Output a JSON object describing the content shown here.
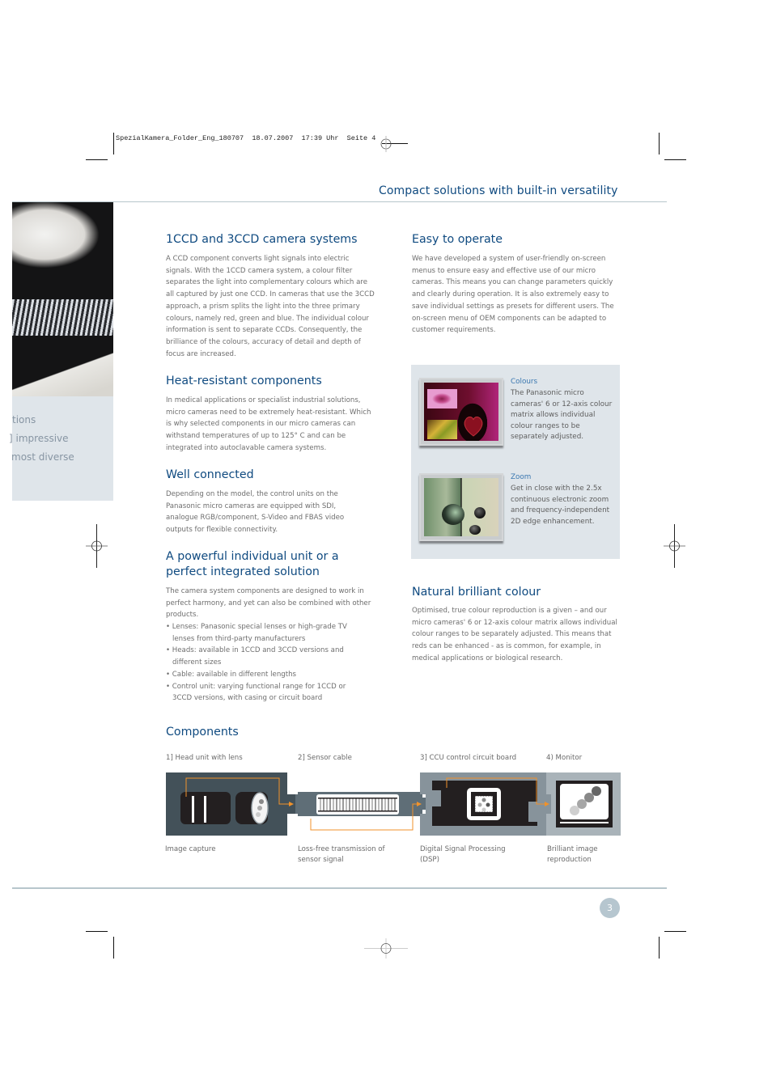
{
  "slug": "SpezialKamera_Folder_Eng_180707  18.07.2007  17:39 Uhr  Seite 4",
  "page_title": "Compact solutions with built-in versatility",
  "sidebar": {
    "lines": [
      "tions",
      "] impressive",
      " most diverse"
    ]
  },
  "sections": {
    "ccd": {
      "title": "1CCD and 3CCD camera systems",
      "body": "A CCD component converts light signals into electric signals. With the 1CCD camera system, a colour filter separates the light into complementary colours which are all captured by just one CCD. In cameras that use the 3CCD approach, a prism splits the light into the three primary colours, namely red, green and blue. The individual colour information is sent to separate CCDs. Consequently, the brilliance of the colours, accuracy of detail and depth of focus are increased."
    },
    "heat": {
      "title": "Heat-resistant components",
      "body": "In medical applications or specialist industrial solutions, micro cameras need to be extremely heat-resistant. Which is why selected components in our micro cameras can withstand temperatures of up to 125° C and can be integrated into autoclavable camera systems."
    },
    "connected": {
      "title": "Well connected",
      "body": "Depending on the model, the control units on the Panasonic micro cameras are equipped with SDI, analogue RGB/component, S-Video and FBAS video outputs for flexible connectivity."
    },
    "powerful": {
      "title_line1": "A powerful individual unit or a",
      "title_line2": "perfect integrated solution",
      "body": "The camera system components are designed to work in perfect harmony, and yet can also be combined with other products.",
      "bullets": [
        "• Lenses: Panasonic special lenses or high-grade TV lenses from third-party manufacturers",
        "• Heads: available in 1CCD and 3CCD versions and different sizes",
        "• Cable: available in different lengths",
        "• Control unit: varying functional range for 1CCD or 3CCD versions, with casing or circuit board"
      ]
    },
    "easy": {
      "title": "Easy to operate",
      "body": "We have developed a system of user-friendly on-screen menus to ensure easy and effective use of our micro cameras. This means you can change parameters quickly and clearly during operation. It is also extremely easy to save individual settings as presets for different users. The on-screen menu of OEM components can be adapted to customer requirements."
    },
    "natural": {
      "title": "Natural brilliant colour",
      "body": "Optimised, true colour reproduction is a given – and our micro cameras' 6 or 12-axis colour matrix allows individual colour ranges to be separately adjusted. This means that reds can be enhanced - as is common, for example, in medical applications or biological research."
    }
  },
  "feature_panel": {
    "colours": {
      "title": "Colours",
      "text": "The Panasonic micro cameras' 6 or 12-axis colour matrix allows individual colour ranges to be separately adjusted."
    },
    "zoom": {
      "title": "Zoom",
      "text": "Get in close with the 2.5x continuous electronic zoom and frequency-independent 2D edge enhancement."
    }
  },
  "components": {
    "title": "Components",
    "items": [
      {
        "label": "1] Head unit with lens",
        "desc": "Image capture"
      },
      {
        "label": "2] Sensor cable",
        "desc": "Loss-free transmission of sensor signal"
      },
      {
        "label": "3] CCU control circuit board",
        "desc": "Digital Signal Processing (DSP)"
      },
      {
        "label": "4) Monitor",
        "desc": "Brilliant image reproduction"
      }
    ],
    "colors": {
      "signal_line": "#f0922b",
      "head_bg": "#435159",
      "cable_bg": "#5f6e77",
      "ccu_bg": "#87939b",
      "monitor_bg": "#a9b3b9"
    }
  },
  "page_number": "3"
}
